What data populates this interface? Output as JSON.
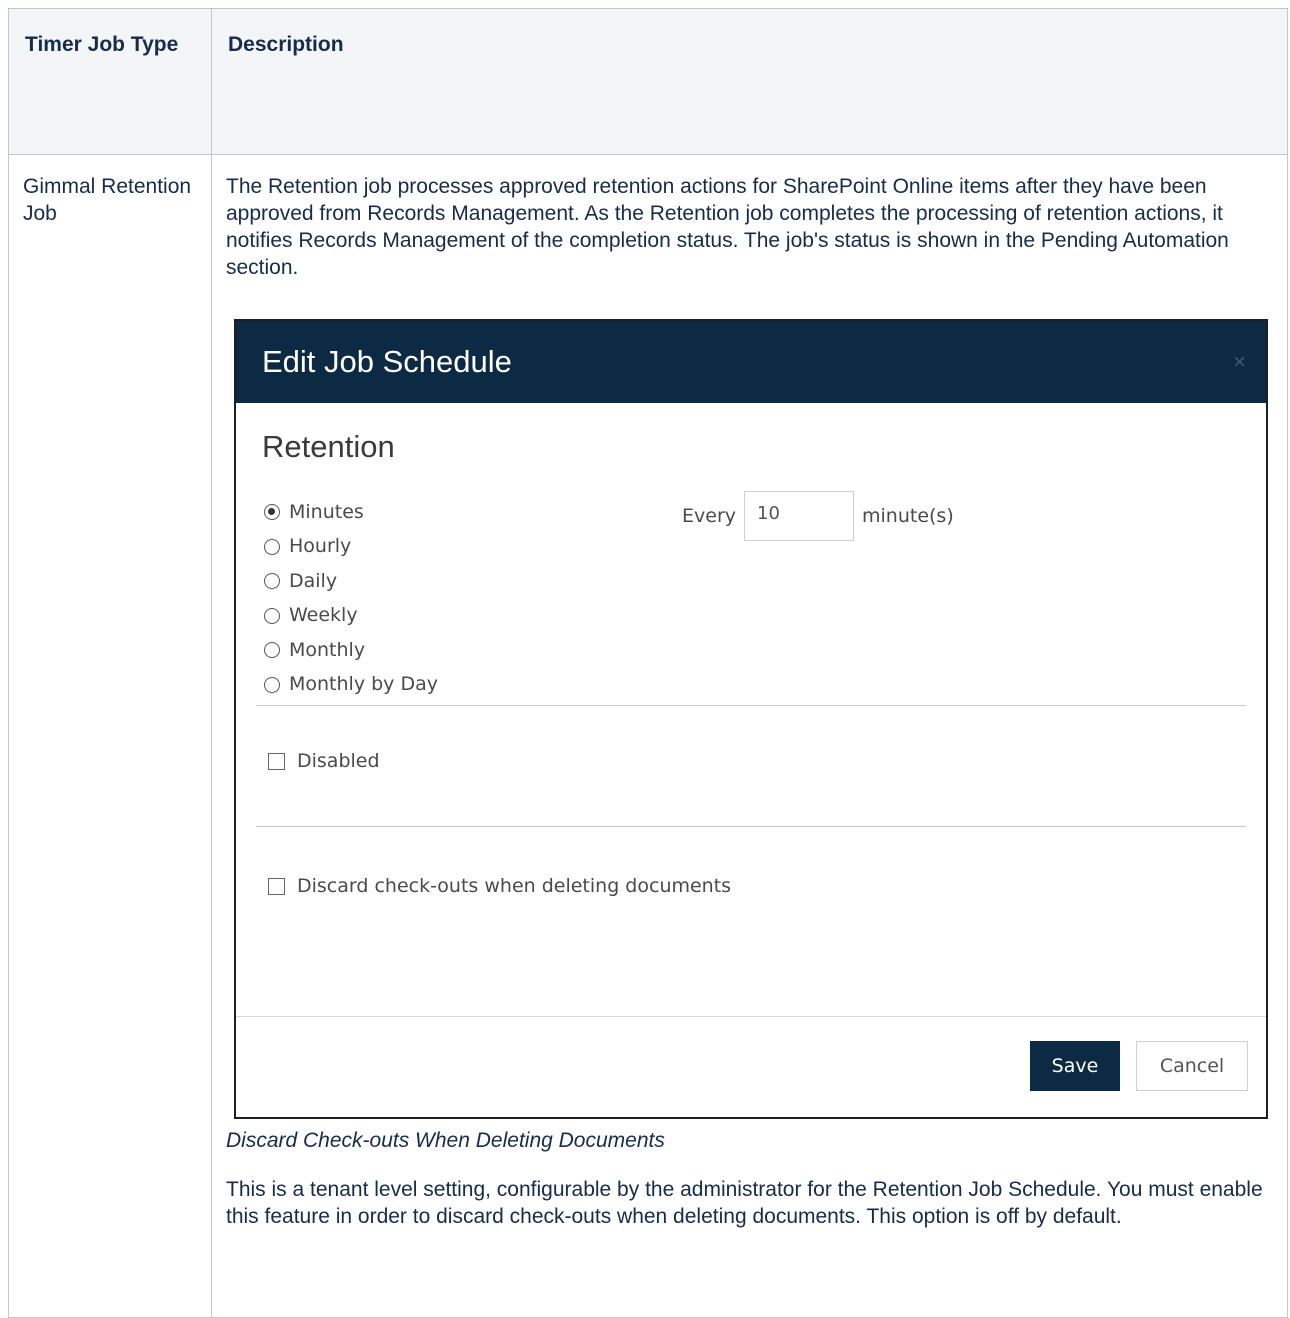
{
  "table": {
    "headers": {
      "type": "Timer Job Type",
      "description": "Description"
    },
    "row": {
      "type": "Gimmal Retention Job",
      "description": "The Retention job processes approved retention actions for SharePoint Online items after they have been approved from Records Management. As the Retention job completes the processing of retention actions, it notifies Records Management of the completion status. The job's status is shown in the Pending Automation section.",
      "caption": "Discard Check-outs When Deleting Documents",
      "note": "This is a tenant level setting, configurable by the administrator for the Retention Job Schedule. You must enable this feature in order to discard check-outs when deleting documents. This option is off by default."
    }
  },
  "dialog": {
    "title": "Edit Job Schedule",
    "close_glyph": "×",
    "section_title": "Retention",
    "frequency_options": [
      {
        "label": "Minutes",
        "checked": true
      },
      {
        "label": "Hourly",
        "checked": false
      },
      {
        "label": "Daily",
        "checked": false
      },
      {
        "label": "Weekly",
        "checked": false
      },
      {
        "label": "Monthly",
        "checked": false
      },
      {
        "label": "Monthly by Day",
        "checked": false
      }
    ],
    "every_label": "Every",
    "every_value": "10",
    "every_unit": "minute(s)",
    "disabled_label": "Disabled",
    "discard_label": "Discard check-outs when deleting documents",
    "save_label": "Save",
    "cancel_label": "Cancel",
    "colors": {
      "header_bg": "#0d2a45",
      "save_bg": "#0d2a45"
    }
  }
}
